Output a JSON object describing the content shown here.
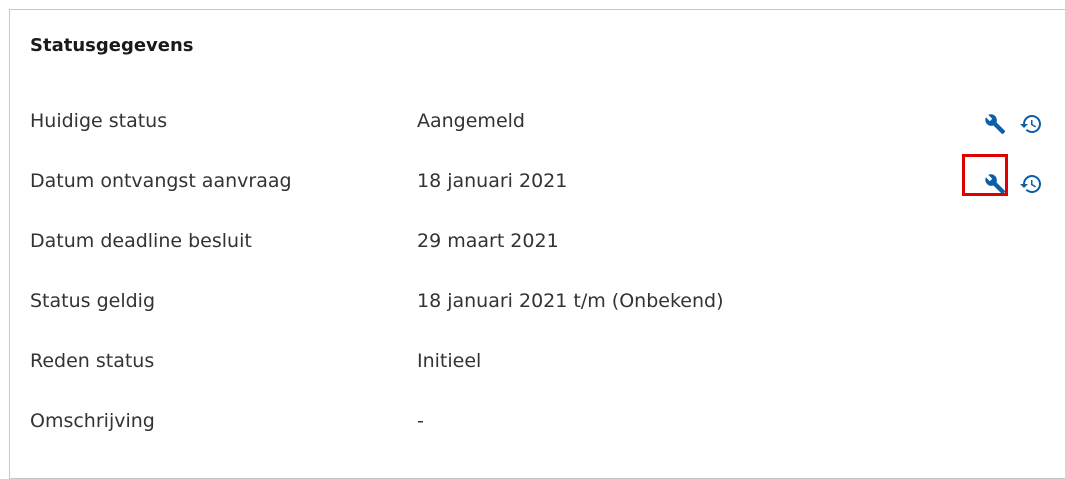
{
  "panel": {
    "title": "Statusgegevens"
  },
  "rows": [
    {
      "label": "Huidige status",
      "value": "Aangemeld",
      "has_actions": true
    },
    {
      "label": "Datum ontvangst aanvraag",
      "value": "18 januari 2021",
      "has_actions": true
    },
    {
      "label": "Datum deadline besluit",
      "value": "29 maart 2021",
      "has_actions": false
    },
    {
      "label": "Status geldig",
      "value": "18 januari 2021 t/m (Onbekend)",
      "has_actions": false
    },
    {
      "label": "Reden status",
      "value": "Initieel",
      "has_actions": false
    },
    {
      "label": "Omschrijving",
      "value": "-",
      "has_actions": false
    }
  ],
  "icons": {
    "edit": "wrench-icon",
    "history": "history-icon"
  },
  "colors": {
    "icon": "#0b5ea8",
    "highlight": "#e00000",
    "border": "#c8c8c8"
  }
}
